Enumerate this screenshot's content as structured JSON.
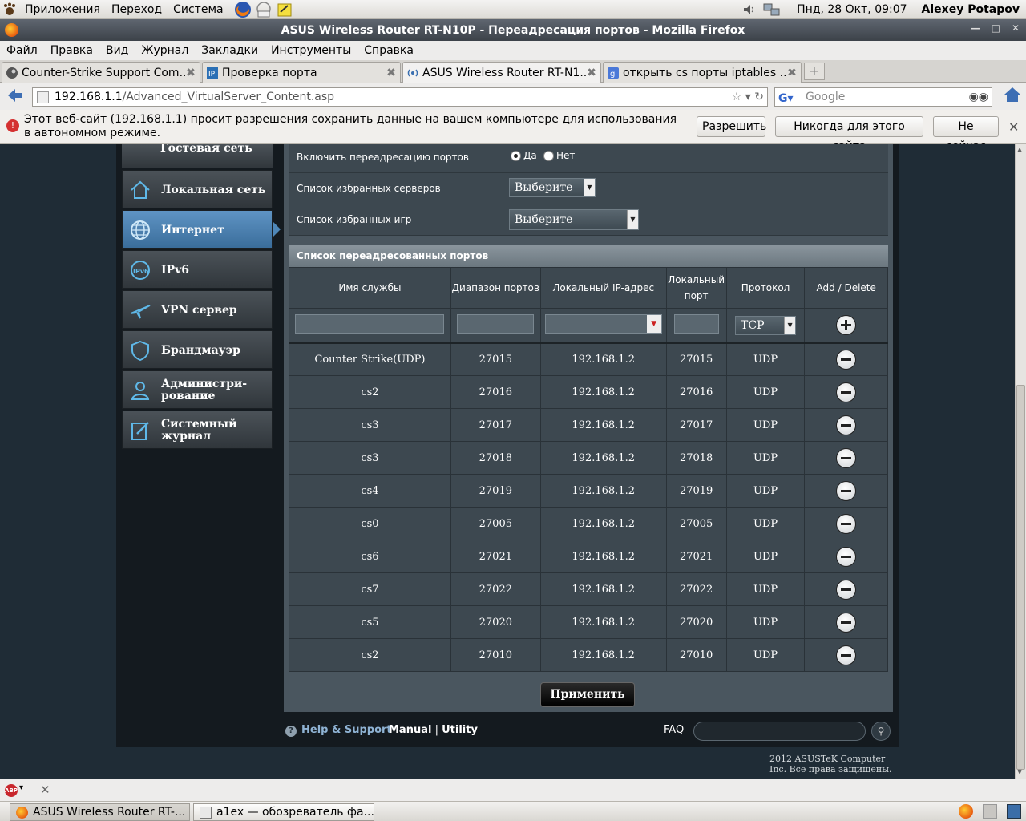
{
  "gnome": {
    "menus": [
      "Приложения",
      "Переход",
      "Система"
    ],
    "datetime": "Пнд, 28 Окт, 09:07",
    "user": "Alexey Potapov"
  },
  "window": {
    "title": "ASUS Wireless Router RT-N10P - Переадресация портов - Mozilla Firefox"
  },
  "menubar": [
    "Файл",
    "Правка",
    "Вид",
    "Журнал",
    "Закладки",
    "Инструменты",
    "Справка"
  ],
  "tabs": [
    {
      "label": "Counter-Strike Support Com..."
    },
    {
      "label": "Проверка порта"
    },
    {
      "label": "ASUS Wireless Router RT-N1..."
    },
    {
      "label": "открыть cs порты iptables ..."
    }
  ],
  "nav": {
    "url_host": "192.168.1.1",
    "url_path": "/Advanced_VirtualServer_Content.asp",
    "search_placeholder": "Google"
  },
  "notification": {
    "message": "Этот веб-сайт (192.168.1.1) просит разрешения сохранить данные на вашем компьютере для использования в автономном режиме.",
    "allow": "Разрешить",
    "never": "Никогда для этого сайта",
    "not_now": "Не сейчас"
  },
  "sidebar": {
    "top_partial": "Гостевая сеть",
    "items": [
      {
        "label": "Локальная сеть"
      },
      {
        "label": "Интернет"
      },
      {
        "label": "IPv6"
      },
      {
        "label": "VPN сервер"
      },
      {
        "label": "Брандмауэр"
      },
      {
        "label": "Администри-\nрование"
      },
      {
        "label": "Системный\nжурнал"
      }
    ]
  },
  "settings": {
    "enable_label": "Включить переадресацию портов",
    "yes": "Да",
    "no": "Нет",
    "servers_label": "Список избранных серверов",
    "games_label": "Список избранных игр",
    "select_placeholder": "Выберите"
  },
  "table": {
    "title": "Список переадресованных портов",
    "headers": [
      "Имя службы",
      "Диапазон портов",
      "Локальный IP-адрес",
      "Локальный порт",
      "Протокол",
      "Add / Delete"
    ],
    "new_protocol": "TCP",
    "rows": [
      {
        "name": "Counter Strike(UDP)",
        "range": "27015",
        "ip": "192.168.1.2",
        "port": "27015",
        "proto": "UDP"
      },
      {
        "name": "cs2",
        "range": "27016",
        "ip": "192.168.1.2",
        "port": "27016",
        "proto": "UDP"
      },
      {
        "name": "cs3",
        "range": "27017",
        "ip": "192.168.1.2",
        "port": "27017",
        "proto": "UDP"
      },
      {
        "name": "cs3",
        "range": "27018",
        "ip": "192.168.1.2",
        "port": "27018",
        "proto": "UDP"
      },
      {
        "name": "cs4",
        "range": "27019",
        "ip": "192.168.1.2",
        "port": "27019",
        "proto": "UDP"
      },
      {
        "name": "cs0",
        "range": "27005",
        "ip": "192.168.1.2",
        "port": "27005",
        "proto": "UDP"
      },
      {
        "name": "cs6",
        "range": "27021",
        "ip": "192.168.1.2",
        "port": "27021",
        "proto": "UDP"
      },
      {
        "name": "cs7",
        "range": "27022",
        "ip": "192.168.1.2",
        "port": "27022",
        "proto": "UDP"
      },
      {
        "name": "cs5",
        "range": "27020",
        "ip": "192.168.1.2",
        "port": "27020",
        "proto": "UDP"
      },
      {
        "name": "cs2",
        "range": "27010",
        "ip": "192.168.1.2",
        "port": "27010",
        "proto": "UDP"
      }
    ]
  },
  "apply": "Применить",
  "footer": {
    "help": "Help & Support",
    "manual": "Manual",
    "sep": "|",
    "utility": "Utility",
    "faq": "FAQ",
    "copyright": "2012 ASUSTeK Computer Inc. Все права защищены."
  },
  "taskbar": [
    {
      "label": "ASUS Wireless Router RT-..."
    },
    {
      "label": "a1ex — обозреватель фа..."
    }
  ],
  "colors": {
    "active_nav": "#4f87b8",
    "content_bg": "#1f2c36",
    "panel_bg": "#4a565f"
  }
}
